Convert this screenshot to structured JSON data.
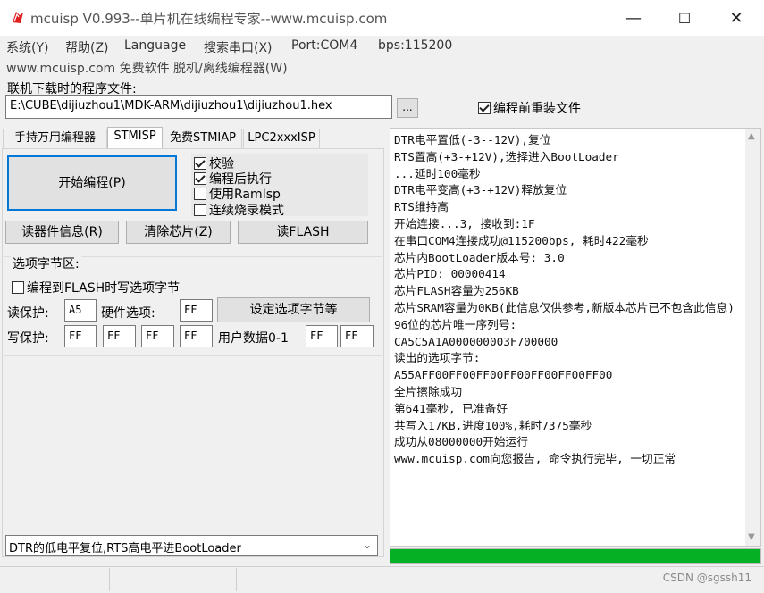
{
  "window": {
    "title": "mcuisp V0.993--单片机在线编程专家--www.mcuisp.com",
    "controls": {
      "minimize": "—",
      "maximize": "☐",
      "close": "✕"
    }
  },
  "menu": {
    "items": [
      "系统(Y)",
      "帮助(Z)",
      "Language",
      "搜索串口(X)",
      "Port:COM4",
      "bps:115200"
    ],
    "row2": "www.mcuisp.com 免费软件 脱机/离线编程器(W)"
  },
  "download": {
    "label": "联机下载时的程序文件:",
    "path": "E:\\CUBE\\dijiuzhou1\\MDK-ARM\\dijiuzhou1\\dijiuzhou1.hex",
    "browse_label": "...",
    "reload_checkbox": {
      "label": "编程前重装文件",
      "checked": true
    }
  },
  "tabs": [
    {
      "label": "手持万用编程器",
      "active": false
    },
    {
      "label": "STMISP",
      "active": true
    },
    {
      "label": "免费STMIAP",
      "active": false
    },
    {
      "label": "LPC2xxxISP",
      "active": false
    }
  ],
  "stmisp": {
    "program_button": "开始编程(P)",
    "options": [
      {
        "label": "校验",
        "checked": true
      },
      {
        "label": "编程后执行",
        "checked": true
      },
      {
        "label": "使用RamIsp",
        "checked": false
      },
      {
        "label": "连续烧录模式",
        "checked": false
      }
    ],
    "read_info_button": "读器件信息(R)",
    "erase_button": "清除芯片(Z)",
    "read_flash_button": "读FLASH",
    "option_bytes": {
      "title": "选项字节区:",
      "program_option_checkbox": {
        "label": "编程到FLASH时写选项字节",
        "checked": false
      },
      "read_protect_label": "读保护:",
      "read_protect_value": "A5",
      "hw_option_label": "硬件选项:",
      "hw_option_value": "FF",
      "set_option_button": "设定选项字节等",
      "write_protect_label": "写保护:",
      "write_protect_values": [
        "FF",
        "FF",
        "FF",
        "FF"
      ],
      "user_data_label": "用户数据0-1",
      "user_data_values": [
        "FF",
        "FF"
      ]
    },
    "boot_mode_select": "DTR的低电平复位,RTS高电平进BootLoader",
    "select_arrow": "⌄"
  },
  "log": {
    "text": "DTR电平置低(-3--12V),复位\nRTS置高(+3-+12V),选择进入BootLoader\n...延时100毫秒\nDTR电平变高(+3-+12V)释放复位\nRTS维持高\n开始连接...3, 接收到:1F\n在串口COM4连接成功@115200bps, 耗时422毫秒\n芯片内BootLoader版本号: 3.0\n芯片PID: 00000414\n芯片FLASH容量为256KB\n芯片SRAM容量为0KB(此信息仅供参考,新版本芯片已不包含此信息)\n96位的芯片唯一序列号:\nCA5C5A1A000000003F700000\n读出的选项字节:\nA55AFF00FF00FF00FF00FF00FF00FF00\n全片擦除成功\n第641毫秒, 已准备好\n共写入17KB,进度100%,耗时7375毫秒\n成功从08000000开始运行\nwww.mcuisp.com向您报告, 命令执行完毕, 一切正常",
    "scroll_up": "▲",
    "scroll_down": "▼"
  },
  "progress": {
    "fraction": 1.0,
    "color": "#06b025"
  },
  "statusbar": {
    "watermark": "CSDN @sgssh11"
  },
  "colors": {
    "accent": "#0078d7",
    "app_icon": "#e02020"
  }
}
